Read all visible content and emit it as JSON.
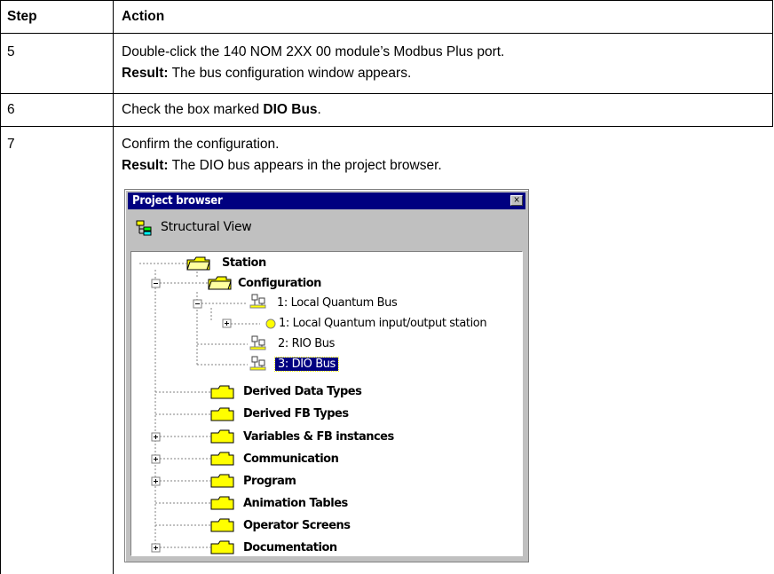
{
  "table": {
    "headers": {
      "step": "Step",
      "action": "Action"
    },
    "rows": [
      {
        "step": "5",
        "line1": "Double-click the 140 NOM 2XX 00 module’s Modbus Plus port.",
        "result_label": "Result:",
        "result_text": " The bus configuration window appears."
      },
      {
        "step": "6",
        "pre": "Check the box marked ",
        "bold": "DIO Bus",
        "post": "."
      },
      {
        "step": "7",
        "line1": "Confirm the configuration.",
        "result_label": "Result:",
        "result_text": " The DIO bus appears in the project browser."
      }
    ]
  },
  "project_browser": {
    "title": "Project browser",
    "close_glyph": "×",
    "view_label": "Structural View",
    "tree": {
      "station": "Station",
      "configuration": "Configuration",
      "bus1": "1: Local Quantum Bus",
      "station1": "1: Local Quantum input/output station",
      "bus2": "2: RIO Bus",
      "bus3": "3: DIO Bus",
      "derived_data": "Derived Data Types",
      "derived_fb": "Derived FB Types",
      "variables": "Variables & FB instances",
      "communication": "Communication",
      "program": "Program",
      "animation": "Animation Tables",
      "operator": "Operator Screens",
      "documentation": "Documentation"
    }
  }
}
